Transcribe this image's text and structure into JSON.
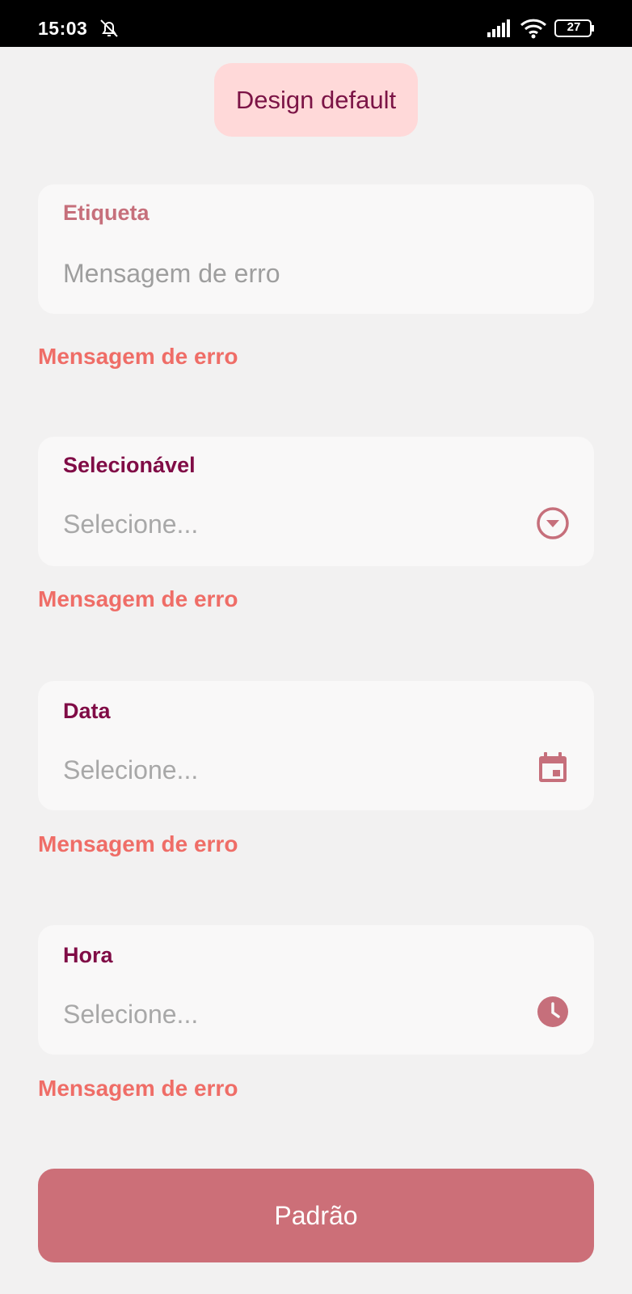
{
  "status_bar": {
    "time": "15:03",
    "battery": "27",
    "icons": [
      "bell-off-icon",
      "signal-icon",
      "wifi-icon",
      "battery-icon"
    ]
  },
  "chip": {
    "label": "Design default"
  },
  "fields": [
    {
      "label": "Etiqueta",
      "value": "Mensagem de erro",
      "error": "Mensagem de erro",
      "icon": null
    },
    {
      "label": "Selecionável",
      "value": "Selecione...",
      "error": "Mensagem de erro",
      "icon": "dropdown-circle-icon"
    },
    {
      "label": "Data",
      "value": "Selecione...",
      "error": "Mensagem de erro",
      "icon": "calendar-icon"
    },
    {
      "label": "Hora",
      "value": "Selecione...",
      "error": "Mensagem de erro",
      "icon": "clock-icon"
    }
  ],
  "primary_button": {
    "label": "Padrão"
  },
  "colors": {
    "background": "#f2f1f1",
    "field_background": "#f9f8f8",
    "label": "#800c46",
    "label_muted": "#c66f7b",
    "error": "#ef6d67",
    "accent": "#cc6f78",
    "chip_background": "#ffd9d9",
    "chip_text": "#7b1446"
  }
}
